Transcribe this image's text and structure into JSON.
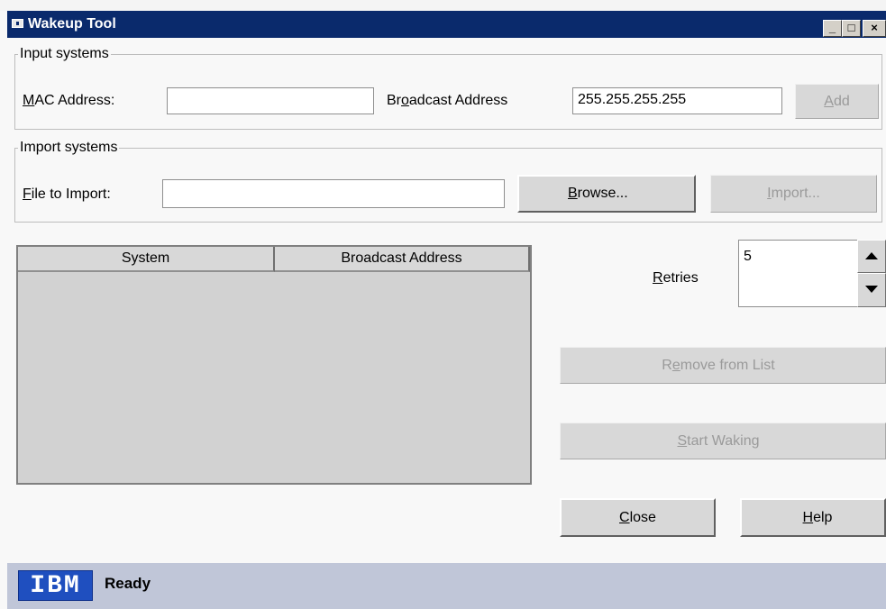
{
  "window": {
    "title": "Wakeup Tool",
    "controls": {
      "minimize": "_",
      "maximize": "□",
      "close": "×"
    },
    "titlebar_color": "#0a2a6c"
  },
  "input_systems": {
    "group_title": "Input systems",
    "mac_label_mnemonic": "M",
    "mac_label_rest": "AC Address:",
    "mac_value": "",
    "broadcast_label_pre": "Br",
    "broadcast_label_mnemonic": "o",
    "broadcast_label_post": "adcast Address",
    "broadcast_value": "255.255.255.255",
    "add_mnemonic": "A",
    "add_rest": "dd"
  },
  "import_systems": {
    "group_title": "Import systems",
    "file_label_mnemonic": "F",
    "file_label_rest": "ile to Import:",
    "file_value": "",
    "browse_mnemonic": "B",
    "browse_rest": "rowse...",
    "import_mnemonic": "I",
    "import_rest": "mport..."
  },
  "systems_table": {
    "columns": [
      "System",
      "Broadcast Address"
    ],
    "rows": []
  },
  "retries": {
    "label_mnemonic": "R",
    "label_rest": "etries",
    "value": "5"
  },
  "actions": {
    "remove_pre": "R",
    "remove_mnemonic": "e",
    "remove_post": "move from List",
    "start_mnemonic": "S",
    "start_rest": "tart Waking",
    "close_mnemonic": "C",
    "close_rest": "lose",
    "help_mnemonic": "H",
    "help_rest": "elp"
  },
  "status_bar": {
    "logo": "IBM",
    "text": "Ready"
  }
}
